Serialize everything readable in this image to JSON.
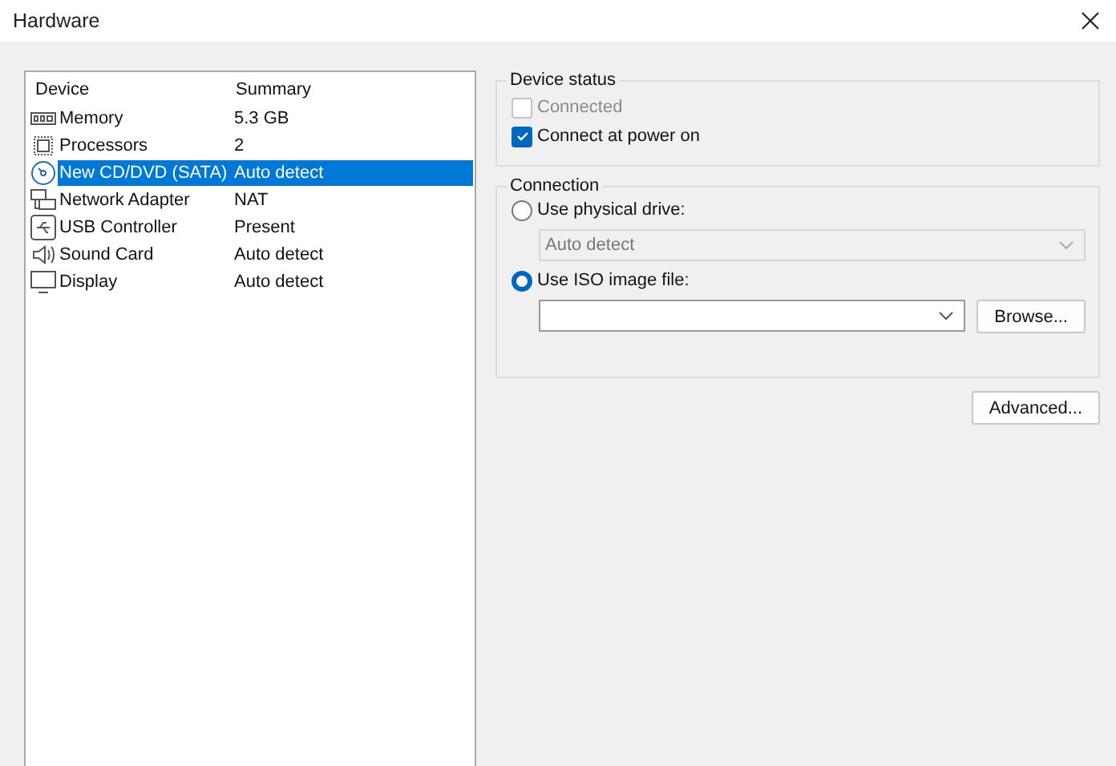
{
  "window": {
    "title": "Hardware"
  },
  "device_list": {
    "columns": [
      "Device",
      "Summary"
    ],
    "rows": [
      {
        "kind": "memory",
        "device": "Memory",
        "summary": "5.3 GB",
        "selected": false
      },
      {
        "kind": "processor",
        "device": "Processors",
        "summary": "2",
        "selected": false
      },
      {
        "kind": "disc",
        "device": "New CD/DVD (SATA)",
        "summary": "Auto detect",
        "selected": true
      },
      {
        "kind": "network",
        "device": "Network Adapter",
        "summary": "NAT",
        "selected": false
      },
      {
        "kind": "usb",
        "device": "USB Controller",
        "summary": "Present",
        "selected": false
      },
      {
        "kind": "sound",
        "device": "Sound Card",
        "summary": "Auto detect",
        "selected": false
      },
      {
        "kind": "display",
        "device": "Display",
        "summary": "Auto detect",
        "selected": false
      }
    ]
  },
  "device_status": {
    "title": "Device status",
    "options": [
      {
        "label": "Connected",
        "checked": false,
        "disabled": true
      },
      {
        "label": "Connect at power on",
        "checked": true,
        "disabled": false
      }
    ]
  },
  "connection": {
    "title": "Connection",
    "physical": {
      "label": "Use physical drive:",
      "selected": false,
      "dropdown": {
        "value": "Auto detect",
        "disabled": true
      }
    },
    "iso": {
      "label": "Use ISO image file:",
      "selected": true,
      "browse_button": "Browse..."
    }
  },
  "advanced_button": "Advanced..."
}
